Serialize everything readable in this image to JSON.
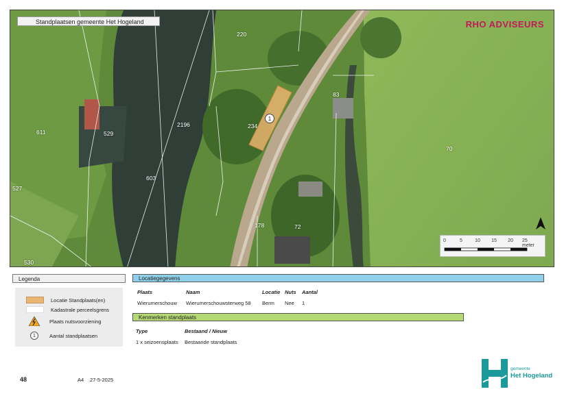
{
  "map": {
    "title": "Standplaatsen gemeente Het Hogeland",
    "brand": "RHO ADVISEURS",
    "parcels": [
      {
        "id": "p220",
        "label": "220"
      },
      {
        "id": "p2196",
        "label": "2196"
      },
      {
        "id": "p234",
        "label": "234"
      },
      {
        "id": "p83",
        "label": "83"
      },
      {
        "id": "p611",
        "label": "611"
      },
      {
        "id": "p529",
        "label": "529"
      },
      {
        "id": "p70",
        "label": "70"
      },
      {
        "id": "p603",
        "label": "603"
      },
      {
        "id": "p527",
        "label": "527"
      },
      {
        "id": "p178",
        "label": "178"
      },
      {
        "id": "p72",
        "label": "72"
      },
      {
        "id": "p530",
        "label": "530"
      }
    ],
    "location_marker": "1",
    "scale": {
      "ticks": [
        "0",
        "5",
        "10",
        "15",
        "20",
        "25 meter"
      ]
    }
  },
  "legend": {
    "title": "Legenda",
    "items": [
      {
        "label": "Locatie Standplaats(en)",
        "icon": "orange-fill-swatch"
      },
      {
        "label": "Kadastrale perceelsgrens",
        "icon": "white-line-swatch"
      },
      {
        "label": "Plaats nutsvoorziening",
        "icon": "warning-icon"
      },
      {
        "label": "Aantal standplaatsen",
        "icon": "number-circle-icon",
        "symbol": "1"
      }
    ]
  },
  "location": {
    "title": "Locatiegegevens",
    "headers": [
      "Plaats",
      "Naam",
      "Locatie",
      "Nuts",
      "Aantal"
    ],
    "row": [
      "Wierumerschouw",
      "Wierumerschouwsterweg 58",
      "Berm",
      "Nee",
      "1"
    ]
  },
  "characteristics": {
    "title": "Kenmerken standplaats",
    "headers": [
      "Type",
      "Bestaand / Nieuw"
    ],
    "row": [
      "1 x seizoensplaats",
      "Bestaande standplaats"
    ]
  },
  "footer": {
    "page": "48",
    "format": "A4",
    "date": "27-5-2025",
    "municipality_small": "gemeente",
    "municipality_big": "Het Hogeland"
  },
  "colors": {
    "accent_blue": "#8fd1ea",
    "accent_green": "#b5d975",
    "site_fill": "#eab676",
    "brand": "#c2185b",
    "municipality": "#1a9a9a"
  }
}
